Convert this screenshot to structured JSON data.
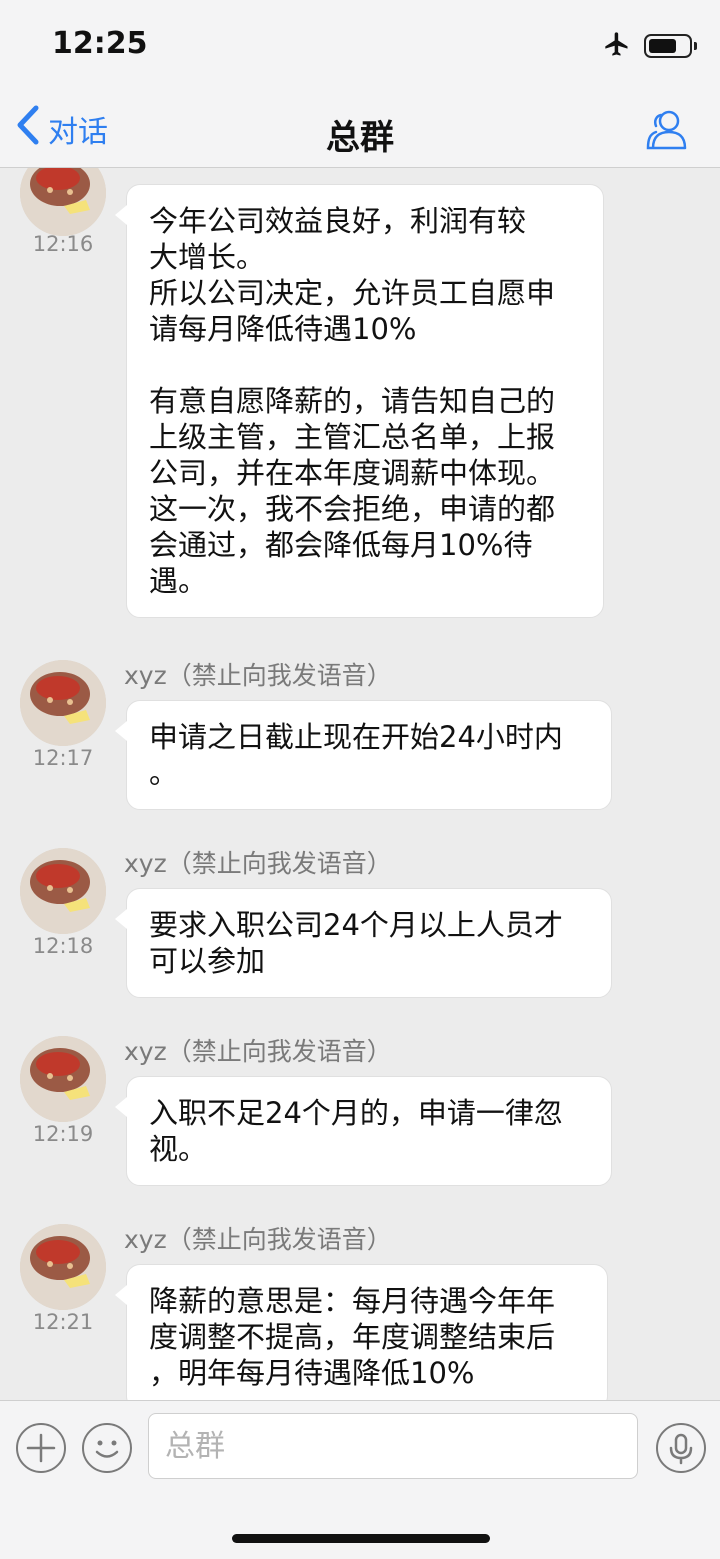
{
  "status": {
    "time": "12:25"
  },
  "nav": {
    "back_label": "对话",
    "title": "总群"
  },
  "messages": [
    {
      "time": "12:16",
      "text": "今年公司效益良好，利润有较\n大增长。\n所以公司决定，允许员工自愿申\n请每月降低待遇10%\n\n有意自愿降薪的，请告知自己的\n上级主管，主管汇总名单，上报\n公司，并在本年度调薪中体现。\n这一次，我不会拒绝，申请的都\n会通过，都会降低每月10%待\n遇。"
    },
    {
      "sender": "xyz（禁止向我发语音）",
      "time": "12:17",
      "text": "申请之日截止现在开始24小时内\n。"
    },
    {
      "sender": "xyz（禁止向我发语音）",
      "time": "12:18",
      "text": "要求入职公司24个月以上人员才\n可以参加"
    },
    {
      "sender": "xyz（禁止向我发语音）",
      "time": "12:19",
      "text": "入职不足24个月的，申请一律忽\n视。"
    },
    {
      "sender": "xyz（禁止向我发语音）",
      "time": "12:21",
      "text": "降薪的意思是：每月待遇今年年\n度调整不提高，年度调整结束后\n，明年每月待遇降低10%"
    }
  ],
  "input": {
    "placeholder": "总群"
  },
  "icons": {
    "back": "chevron-left-icon",
    "profile": "group-profile-icon",
    "airplane": "airplane-icon",
    "battery": "battery-icon",
    "add": "plus-icon",
    "emoji": "emoji-icon",
    "voice": "microphone-icon"
  },
  "colors": {
    "accent": "#2f7ff0",
    "background": "#ececec",
    "bubble": "#ffffff"
  }
}
